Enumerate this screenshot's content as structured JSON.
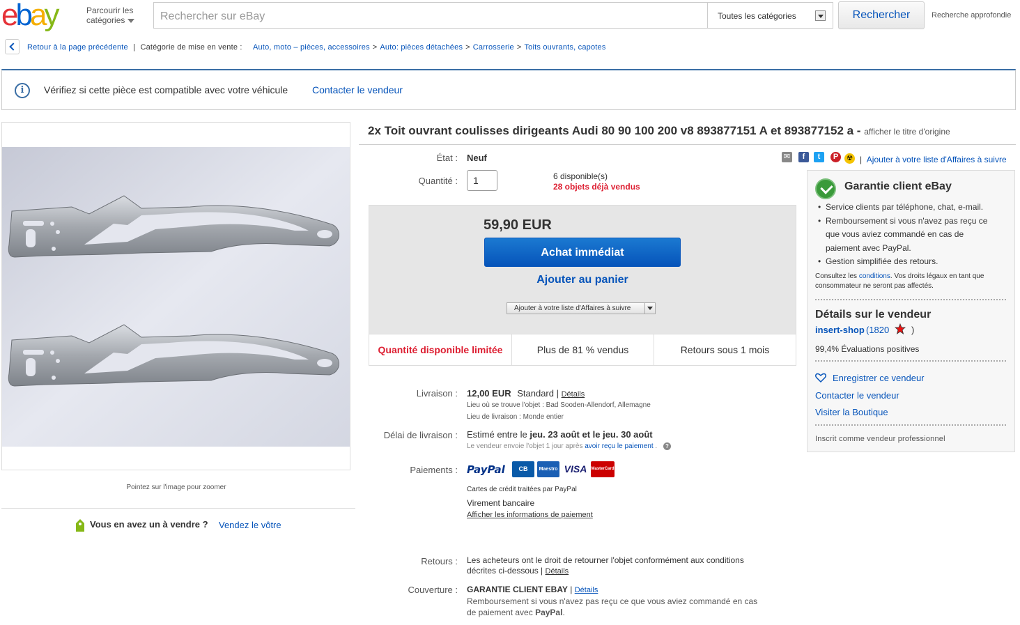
{
  "header": {
    "logo_letters": [
      "e",
      "b",
      "a",
      "y"
    ],
    "logo_colors": [
      "#e53238",
      "#0064d2",
      "#f5af02",
      "#86b817"
    ],
    "browse_line1": "Parcourir les",
    "browse_line2": "catégories",
    "search_placeholder": "Rechercher sur eBay",
    "category_selected": "Toutes les catégories",
    "search_button": "Rechercher",
    "advanced_search": "Recherche approfondie"
  },
  "breadcrumb": {
    "back_label": "Retour à la page précédente",
    "category_label": "Catégorie de mise en vente :",
    "items": [
      "Auto, moto – pièces, accessoires",
      "Auto: pièces détachées",
      "Carrosserie",
      "Toits ouvrants, capotes"
    ]
  },
  "compat": {
    "icon": "info-icon",
    "text": "Vérifiez si cette pièce est compatible avec votre véhicule",
    "link": "Contacter le vendeur"
  },
  "gallery": {
    "zoom_hint": "Pointez sur l'image pour zoomer",
    "sell_question": "Vous en avez un à vendre ?",
    "sell_link": "Vendez le vôtre"
  },
  "item": {
    "title": "2x Toit ouvrant coulisses dirigeants Audi 80 90 100 200 v8 893877151 A et 893877152 a -",
    "original_title_link": "afficher le titre d'origine",
    "condition_label": "État :",
    "condition_value": "Neuf",
    "quantity_label": "Quantité :",
    "quantity_value": "1",
    "available": "6 disponible(s)",
    "sold": "28 objets déjà vendus",
    "price": "59,90 EUR",
    "buy_now": "Achat immédiat",
    "add_to_cart": "Ajouter au panier",
    "add_to_watch_small": "Ajouter à votre liste d'Affaires à suivre",
    "stats": [
      "Quantité disponible limitée",
      "Plus de 81 % vendus",
      "Retours sous 1 mois"
    ]
  },
  "shipping": {
    "label": "Livraison :",
    "price": "12,00 EUR",
    "method": "Standard |",
    "details": "Détails",
    "location": "Lieu où se trouve l'objet : Bad Sooden-Allendorf, Allemagne",
    "ships_to": "Lieu de livraison : Monde entier"
  },
  "delivery": {
    "label": "Délai de livraison :",
    "estimate_prefix": "Estimé entre le",
    "estimate_bold": "jeu. 23 août et le jeu. 30 août",
    "note_prefix": "Le vendeur envoie l'objet 1 jour après",
    "note_link": "avoir reçu le paiement",
    "help_icon": "question-icon"
  },
  "payments": {
    "label": "Paiements :",
    "paypal_logo": "PayPal",
    "cards": [
      "CB",
      "Maestro",
      "VISA",
      "MasterCard"
    ],
    "card_colors": [
      "#0a5aa8",
      "#1a5fb4",
      "#1a1f71",
      "#cc0000"
    ],
    "card_note": "Cartes de crédit traitées par PayPal",
    "bank": "Virement bancaire",
    "info_link": "Afficher les informations de paiement"
  },
  "returns": {
    "label": "Retours :",
    "text_line1": "Les acheteurs ont le droit de retourner l'objet conformément aux conditions",
    "text_line2": "décrites ci-dessous |",
    "details": "Détails"
  },
  "coverage": {
    "label": "Couverture :",
    "title": "GARANTIE CLIENT EBAY",
    "separator": "|",
    "details": "Détails",
    "text_line1": "Remboursement si vous n'avez pas reçu ce que vous aviez commandé en cas",
    "text_line2_prefix": "de paiement avec",
    "text_line2_bold": "PayPal",
    "text_line2_suffix": "."
  },
  "social": {
    "icons": [
      "email-icon",
      "facebook-icon",
      "twitter-icon",
      "pinterest-icon",
      "radiation-icon"
    ],
    "watch_link": "Ajouter à votre liste d'Affaires à suivre",
    "separator": "|"
  },
  "guarantee": {
    "title": "Garantie client eBay",
    "bullets": [
      "Service clients par téléphone, chat, e-mail.",
      "Remboursement si vous n'avez pas reçu ce",
      "que vous aviez commandé en cas de",
      "paiement avec PayPal.",
      "Gestion simplifiée des retours."
    ],
    "note_prefix": "Consultez les",
    "note_link": "conditions",
    "note_suffix": ". Vos droits légaux en tant que consommateur ne seront pas affectés."
  },
  "seller": {
    "heading": "Détails sur le vendeur",
    "name": "insert-shop",
    "score": "(1820",
    "close_paren": ")",
    "positive": "99,4% Évaluations positives",
    "save": "Enregistrer ce vendeur",
    "contact": "Contacter le vendeur",
    "store": "Visiter la Boutique",
    "pro": "Inscrit comme vendeur professionnel"
  }
}
